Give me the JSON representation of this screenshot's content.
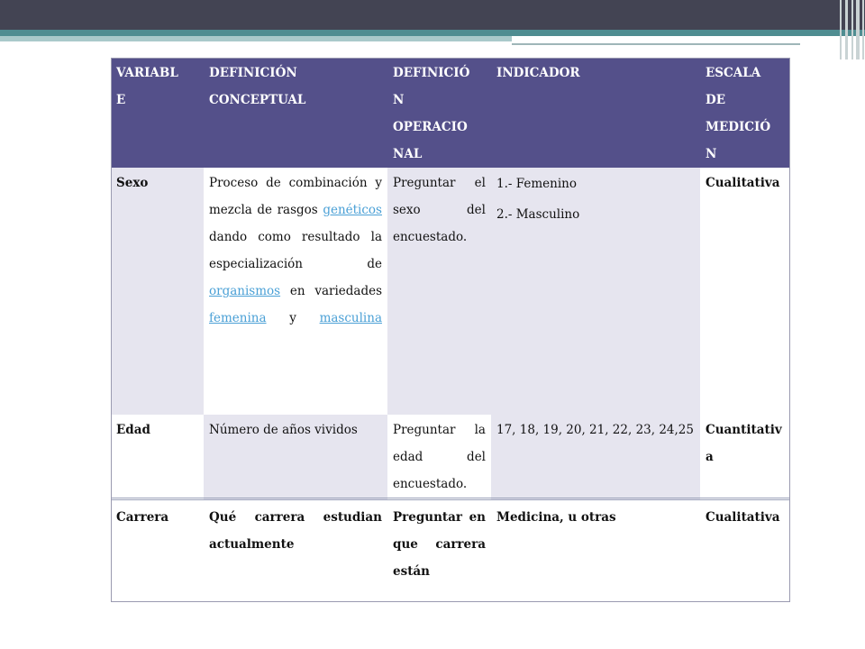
{
  "table": {
    "headers": [
      "VARIABL E",
      "DEFINICIÓN CONCEPTUAL",
      "DEFINICIÓ N OPERACIO NAL",
      "INDICADOR",
      "ESCALA DE MEDICIÓ N"
    ],
    "header_lines": [
      [
        "VARIABL",
        "E"
      ],
      [
        "DEFINICIÓN",
        "CONCEPTUAL"
      ],
      [
        "DEFINICIÓ",
        "N",
        "OPERACIO",
        "NAL"
      ],
      [
        "INDICADOR"
      ],
      [
        "ESCALA",
        "DE",
        "MEDICIÓ",
        "N"
      ]
    ],
    "rows": [
      {
        "variable": "Sexo",
        "def_conceptual": {
          "t1": "Proceso de combinación y mezcla de rasgos ",
          "l1": "genéticos",
          "t2": " dando como resultado la especialización de ",
          "l2": "organismos",
          "t3": " en variedades ",
          "l3": "femenina",
          "t4": " y ",
          "l4": "masculina"
        },
        "def_operacional": "Preguntar el sexo del encuestado.",
        "indicador": [
          "1.- Femenino",
          "2.- Masculino"
        ],
        "escala": "Cualitativa"
      },
      {
        "variable": "Edad",
        "def_conceptual": "Número de años vividos",
        "def_operacional": "Preguntar la edad del encuestado.",
        "indicador": "17, 18, 19, 20, 21, 22, 23, 24,25",
        "escala": "Cuantitativa"
      },
      {
        "variable": "Carrera",
        "def_conceptual": "Qué carrera estudian actualmente",
        "def_operacional": "Preguntar en que carrera están",
        "indicador": "Medicina, u otras",
        "escala": "Cualitativa"
      }
    ]
  }
}
